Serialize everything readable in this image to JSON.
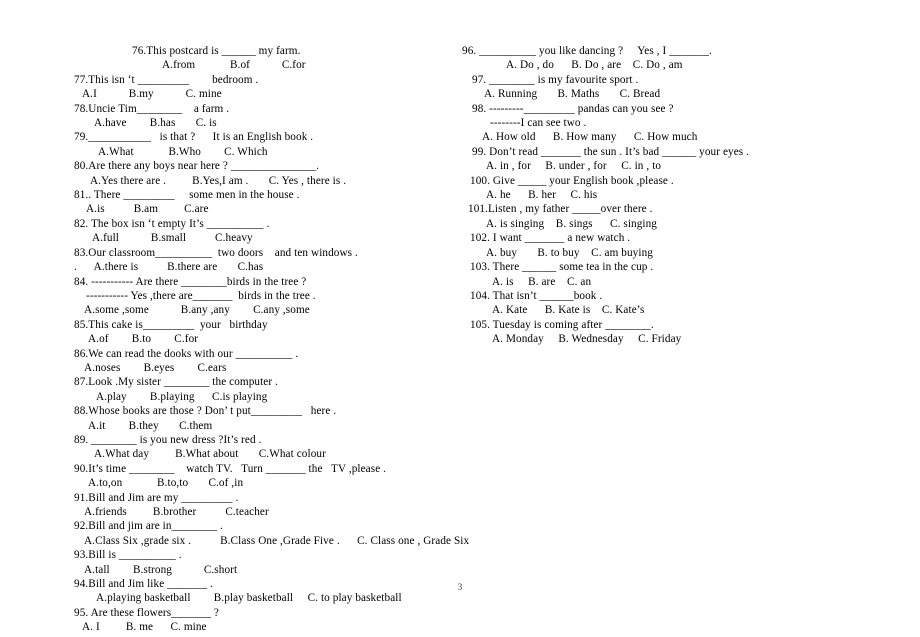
{
  "document": {
    "page_number": "3",
    "background_color": "#ffffff",
    "text_color": "#000000",
    "blank_rule_color": "#555555"
  },
  "left_column": {
    "lines": [
      {
        "indent": 58,
        "text": "76.This postcard is ______ my farm."
      },
      {
        "indent": 88,
        "text": "A.from            B.of           C.for"
      },
      {
        "indent": 0,
        "text": "77.This isn ‘t _________        bedroom ."
      },
      {
        "indent": 8,
        "text": "A.I           B.my           C. mine"
      },
      {
        "indent": 0,
        "text": "78.Uncie Tim________    a farm ."
      },
      {
        "indent": 20,
        "text": "A.have        B.has       C. is"
      },
      {
        "indent": 0,
        "text": "79.___________   is that ?      It is an English book ."
      },
      {
        "indent": 24,
        "text": "A.What            B.Who        C. Which"
      },
      {
        "indent": 0,
        "text": "80.Are there any boys near here ? _______________."
      },
      {
        "indent": 16,
        "text": "A.Yes there are .         B.Yes,I am .       C. Yes , there is ."
      },
      {
        "indent": 0,
        "text": "81.. There _________     some men in the house ."
      },
      {
        "indent": 12,
        "text": "A.is          B.am         C.are"
      },
      {
        "indent": 0,
        "text": "82. The box isn ‘t empty It’s __________ ."
      },
      {
        "indent": 18,
        "text": "A.full           B.small          C.heavy"
      },
      {
        "indent": 0,
        "text": "83.Our classroom__________  two doors    and ten windows ."
      },
      {
        "indent": 0,
        "text": ".      A.there is          B.there are       C.has"
      },
      {
        "indent": 0,
        "text": "84. ----------- Are there ________birds in the tree ?"
      },
      {
        "indent": 12,
        "text": "----------- Yes ,there are_______  birds in the tree ."
      },
      {
        "indent": 10,
        "text": "A.some ,some           B.any ,any        C.any ,some"
      },
      {
        "indent": 0,
        "text": "85.This cake is_________  your   birthday"
      },
      {
        "indent": 14,
        "text": "A.of        B.to        C.for"
      },
      {
        "indent": 0,
        "text": "86.We can read the dooks with our __________ ."
      },
      {
        "indent": 10,
        "text": "A.noses        B.eyes        C.ears"
      },
      {
        "indent": 0,
        "text": "87.Look .My sister ________ the computer ."
      },
      {
        "indent": 22,
        "text": "A.play        B.playing      C.is playing"
      },
      {
        "indent": 0,
        "text": "88.Whose books are those ? Don’ t put_________   here ."
      },
      {
        "indent": 14,
        "text": "A.it        B.they       C.them"
      },
      {
        "indent": 0,
        "text": "89. ________ is you new dress ?It’s red ."
      },
      {
        "indent": 20,
        "text": "A.What day         B.What about       C.What colour"
      },
      {
        "indent": 0,
        "text": "90.It’s time ________    watch TV.   Turn _______ the   TV ,please ."
      },
      {
        "indent": 14,
        "text": "A.to,on            B.to,to       C.of ,in"
      },
      {
        "indent": 0,
        "text": "91.Bill and Jim are my _________ ."
      },
      {
        "indent": 10,
        "text": "A.friends         B.brother          C.teacher"
      },
      {
        "indent": 0,
        "text": "92.Bill and jim are in________ ."
      },
      {
        "indent": 10,
        "text": "A.Class Six ,grade six .          B.Class One ,Grade Five .      C. Class one , Grade Six"
      },
      {
        "indent": 0,
        "text": "93.Bill is __________ ."
      },
      {
        "indent": 10,
        "text": "A.tall        B.strong           C.short"
      },
      {
        "indent": 0,
        "text": "94.Bill and Jim like _______ ."
      },
      {
        "indent": 22,
        "text": "A.playing basketball        B.play basketball     C. to play basketball"
      },
      {
        "indent": 0,
        "text": "95. Are these flowers_______ ?"
      },
      {
        "indent": 8,
        "text": "A. I         B. me      C. mine"
      }
    ]
  },
  "right_column": {
    "lines": [
      {
        "indent": 0,
        "text": "96. __________ you like dancing ?     Yes , I _______."
      },
      {
        "indent": 44,
        "text": "A. Do , do      B. Do , are    C. Do , am"
      },
      {
        "indent": 10,
        "text": "97. ________ is my favourite sport ."
      },
      {
        "indent": 22,
        "text": "A. Running       B. Maths       C. Bread"
      },
      {
        "indent": 10,
        "text": "98. ---------_________ pandas can you see ?"
      },
      {
        "indent": 28,
        "text": "--------I can see two ."
      },
      {
        "indent": 20,
        "text": "A. How old      B. How many      C. How much"
      },
      {
        "indent": 10,
        "text": "99. Don’t read _______ the sun . It’s bad ______ your eyes ."
      },
      {
        "indent": 24,
        "text": "A. in , for     B. under , for     C. in , to"
      },
      {
        "indent": 8,
        "text": "100. Give _____ your English book ,please ."
      },
      {
        "indent": 24,
        "text": "A. he      B. her     C. his"
      },
      {
        "indent": 6,
        "text": "101.Listen , my father _____over there ."
      },
      {
        "indent": 24,
        "text": "A. is singing    B. sings      C. singing"
      },
      {
        "indent": 8,
        "text": "102. I want _______ a new watch ."
      },
      {
        "indent": 24,
        "text": "A. buy       B. to buy    C. am buying"
      },
      {
        "indent": 8,
        "text": "103. There ______ some tea in the cup ."
      },
      {
        "indent": 30,
        "text": "A. is     B. are    C. an"
      },
      {
        "indent": 8,
        "text": "104. That isn’t ______book ."
      },
      {
        "indent": 30,
        "text": "A. Kate      B. Kate is    C. Kate’s"
      },
      {
        "indent": 8,
        "text": "105. Tuesday is coming after ________."
      },
      {
        "indent": 30,
        "text": "A. Monday     B. Wednesday     C. Friday"
      }
    ]
  }
}
